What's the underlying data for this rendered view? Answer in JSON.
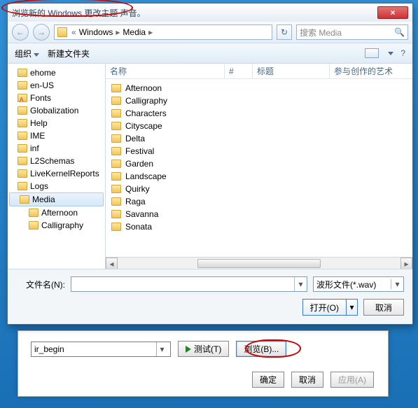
{
  "dialog": {
    "title": "浏览新的 Windows 更改主题 声音。",
    "close_glyph": "×",
    "nav_back_glyph": "←",
    "nav_fwd_glyph": "→",
    "breadcrumb": {
      "overflow": "«",
      "seg1": "Windows",
      "seg2": "Media",
      "chev": "▸"
    },
    "refresh_glyph": "↻",
    "search_placeholder": "搜索 Media",
    "search_icon_glyph": "🔍",
    "toolbar": {
      "organize": "组织",
      "newfolder": "新建文件夹",
      "help_glyph": "?"
    },
    "columns": {
      "name": "名称",
      "num": "#",
      "title": "标题",
      "artist": "参与创作的艺术"
    },
    "filename_label": "文件名(N):",
    "filename_value": "",
    "filter": "波形文件(*.wav)",
    "open_btn": "打开(O)",
    "cancel_btn": "取消"
  },
  "nav_items": [
    {
      "label": "ehome",
      "sub": false,
      "sel": false
    },
    {
      "label": "en-US",
      "sub": false,
      "sel": false
    },
    {
      "label": "Fonts",
      "sub": false,
      "sel": false,
      "iconA": true
    },
    {
      "label": "Globalization",
      "sub": false,
      "sel": false
    },
    {
      "label": "Help",
      "sub": false,
      "sel": false
    },
    {
      "label": "IME",
      "sub": false,
      "sel": false
    },
    {
      "label": "inf",
      "sub": false,
      "sel": false
    },
    {
      "label": "L2Schemas",
      "sub": false,
      "sel": false
    },
    {
      "label": "LiveKernelReports",
      "sub": false,
      "sel": false
    },
    {
      "label": "Logs",
      "sub": false,
      "sel": false
    },
    {
      "label": "Media",
      "sub": false,
      "sel": true
    },
    {
      "label": "Afternoon",
      "sub": true,
      "sel": false
    },
    {
      "label": "Calligraphy",
      "sub": true,
      "sel": false
    }
  ],
  "file_items": [
    "Afternoon",
    "Calligraphy",
    "Characters",
    "Cityscape",
    "Delta",
    "Festival",
    "Garden",
    "Landscape",
    "Quirky",
    "Raga",
    "Savanna",
    "Sonata"
  ],
  "bgwin": {
    "combo_value": "ir_begin",
    "test_btn": "测试(T)",
    "browse_btn": "浏览(B)...",
    "ok_btn": "确定",
    "cancel_btn": "取消",
    "apply_btn": "应用(A)"
  }
}
